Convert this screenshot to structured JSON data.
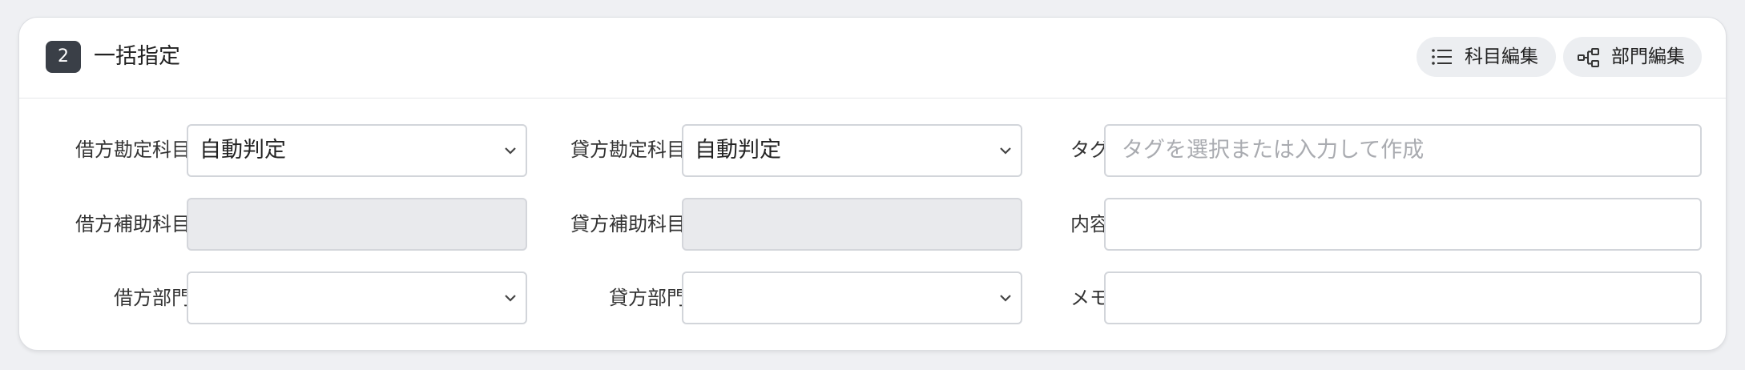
{
  "section": {
    "step": "2",
    "title": "一括指定"
  },
  "actions": {
    "account_edit": "科目編集",
    "dept_edit": "部門編集"
  },
  "fields": {
    "debit_account": {
      "label": "借方勘定科目",
      "value": "自動判定"
    },
    "credit_account": {
      "label": "貸方勘定科目",
      "value": "自動判定"
    },
    "tag": {
      "label": "タグ",
      "placeholder": "タグを選択または入力して作成"
    },
    "debit_sub_account": {
      "label": "借方補助科目",
      "value": ""
    },
    "credit_sub_account": {
      "label": "貸方補助科目",
      "value": ""
    },
    "content": {
      "label": "内容",
      "value": ""
    },
    "debit_department": {
      "label": "借方部門",
      "value": ""
    },
    "credit_department": {
      "label": "貸方部門",
      "value": ""
    },
    "memo": {
      "label": "メモ",
      "value": ""
    }
  },
  "icons": {
    "account_edit": "list-icon",
    "dept_edit": "hierarchy-icon",
    "select": "chevron-down-icon"
  },
  "colors": {
    "badge": "#3a3f47",
    "pill_bg": "#eceef1",
    "disabled_bg": "#e9eaed",
    "page_bg": "#eff0f3"
  }
}
